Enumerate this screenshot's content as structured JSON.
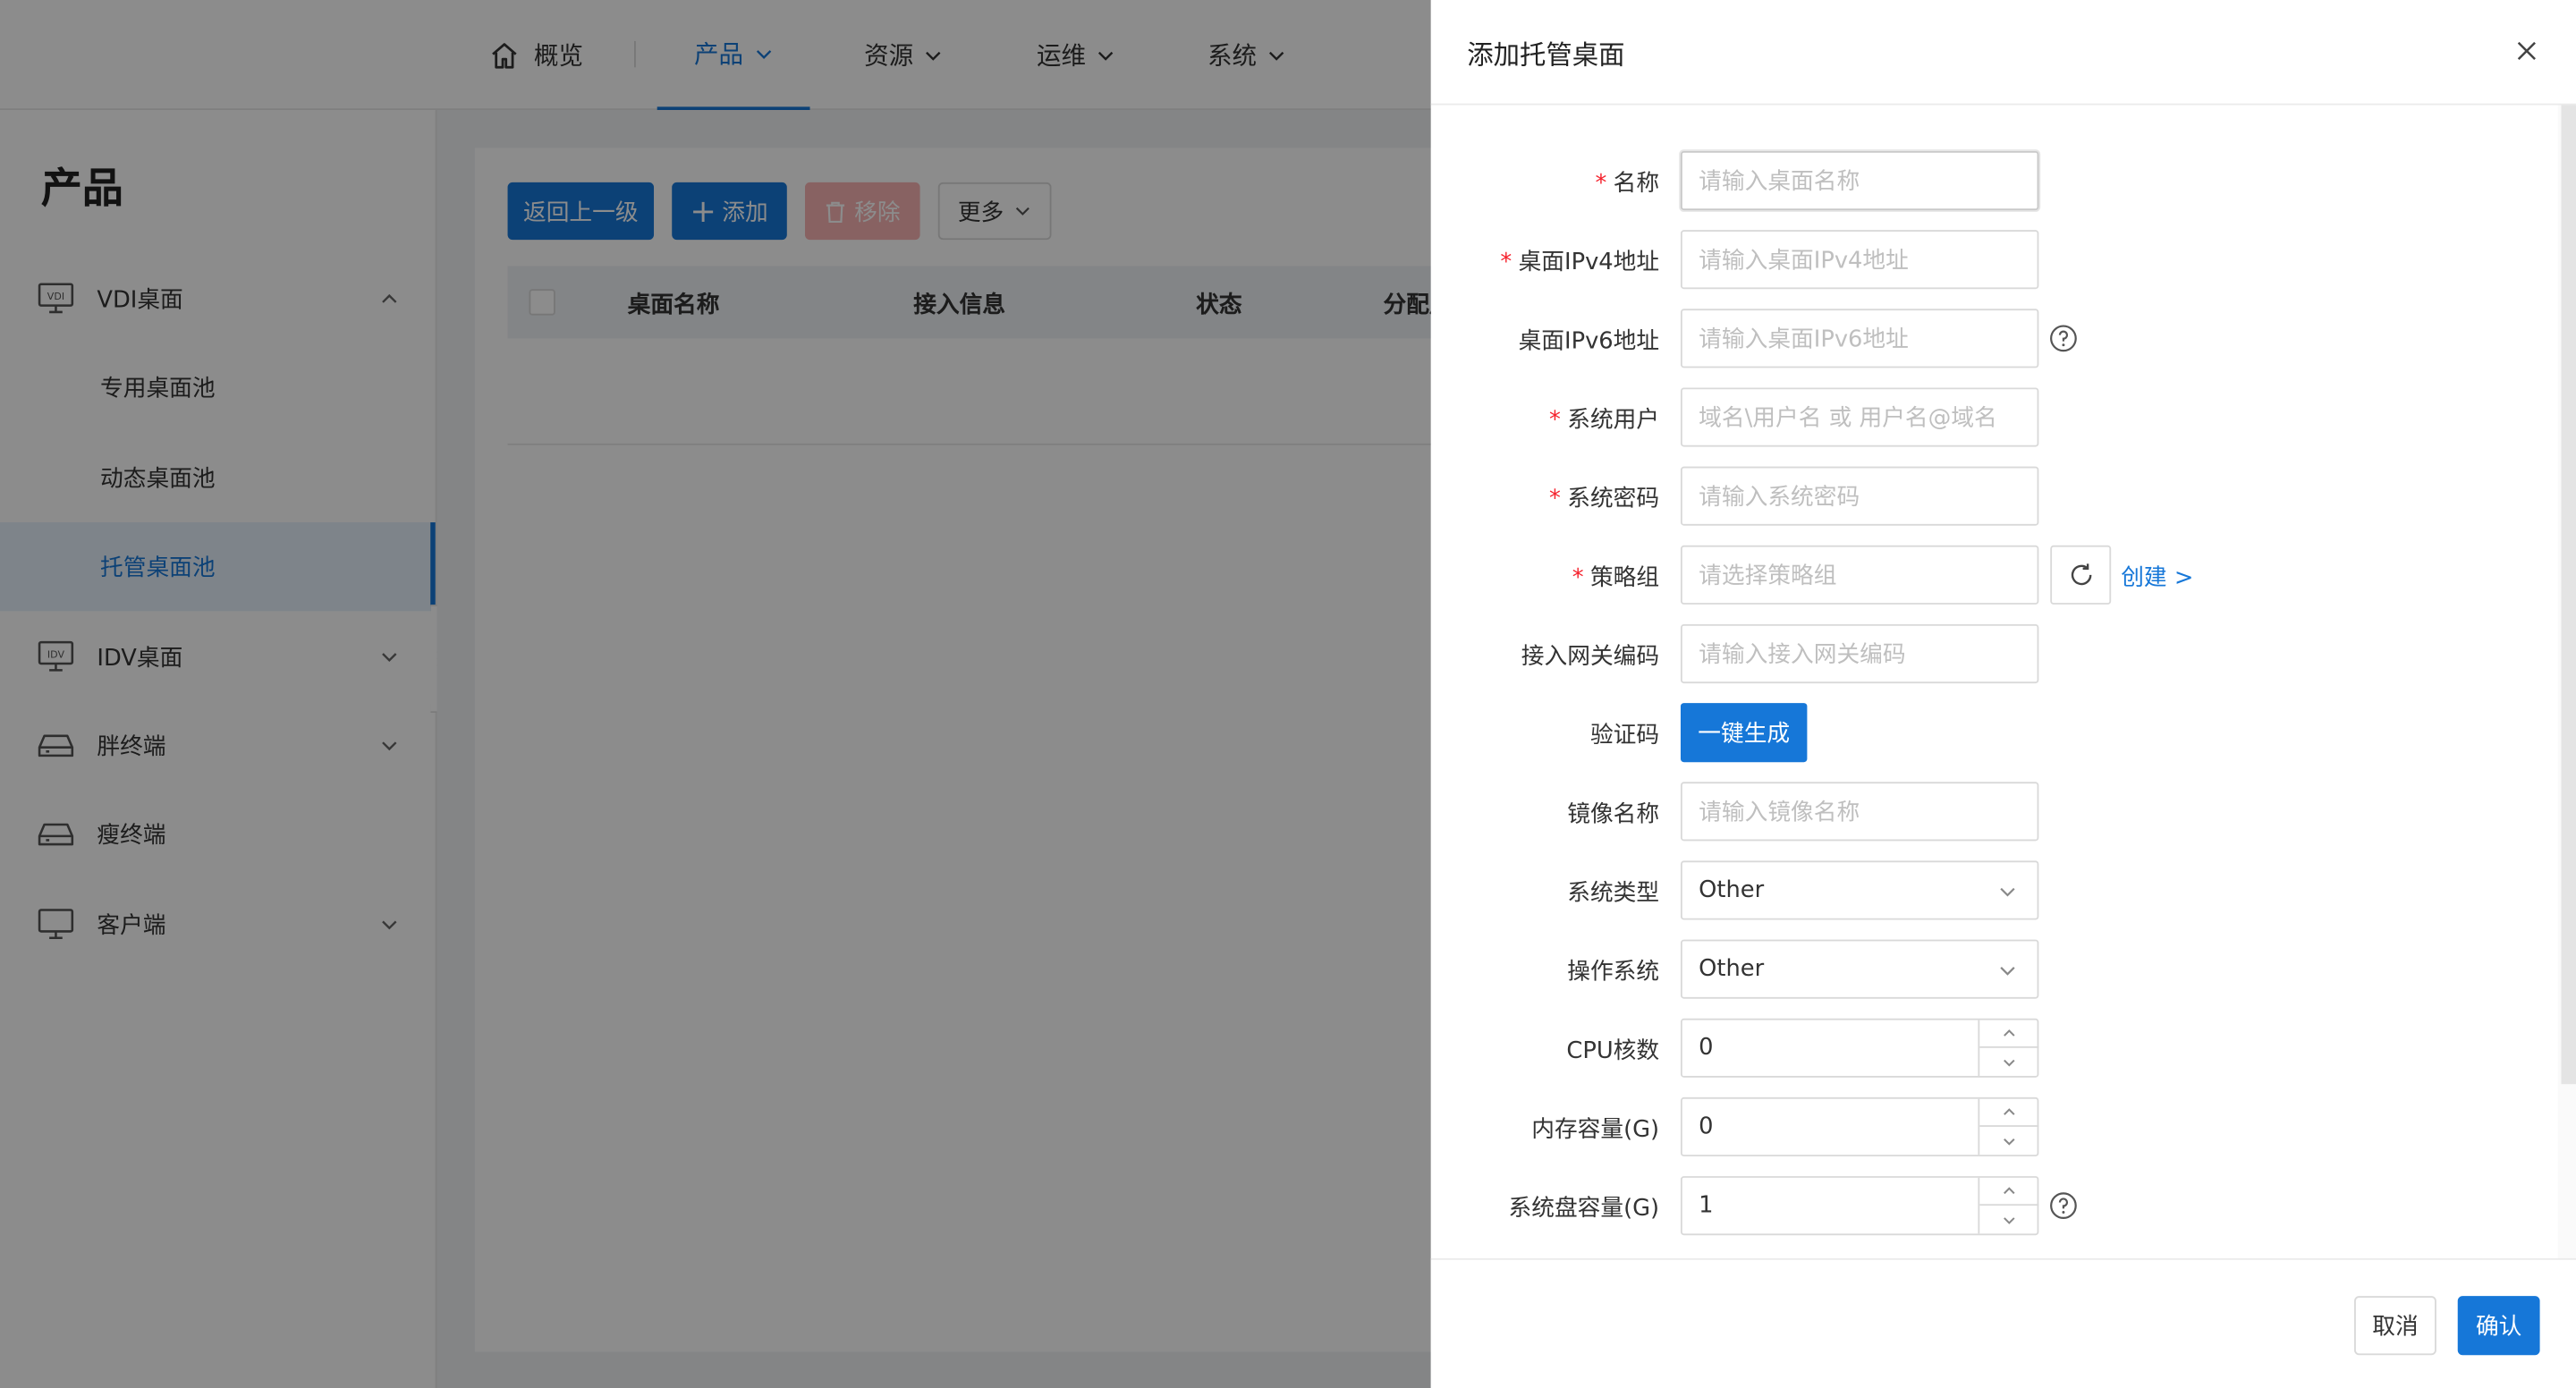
{
  "nav": {
    "items": [
      {
        "label": "概览",
        "icon": "home-icon"
      },
      {
        "label": "产品",
        "icon": "chevron-down-icon",
        "active": true
      },
      {
        "label": "资源",
        "icon": "chevron-down-icon"
      },
      {
        "label": "运维",
        "icon": "chevron-down-icon"
      },
      {
        "label": "系统",
        "icon": "chevron-down-icon"
      }
    ]
  },
  "sidebar": {
    "title": "产品",
    "items": [
      {
        "label": "VDI桌面",
        "icon": "vdi-monitor-icon",
        "expanded": true
      },
      {
        "label": "专用桌面池"
      },
      {
        "label": "动态桌面池"
      },
      {
        "label": "托管桌面池",
        "active": true
      },
      {
        "label": "IDV桌面",
        "icon": "idv-monitor-icon"
      },
      {
        "label": "胖终端",
        "icon": "terminal-device-icon"
      },
      {
        "label": "瘦终端",
        "icon": "terminal-device-icon"
      },
      {
        "label": "客户端",
        "icon": "desktop-monitor-icon"
      }
    ]
  },
  "toolbar": {
    "back_label": "返回上一级",
    "add_label": "添加",
    "remove_label": "移除",
    "more_label": "更多"
  },
  "table": {
    "columns": [
      "桌面名称",
      "接入信息",
      "状态",
      "分配用"
    ]
  },
  "drawer": {
    "title": "添加托管桌面",
    "fields": {
      "name": {
        "label": "名称",
        "required": true,
        "placeholder": "请输入桌面名称"
      },
      "ipv4": {
        "label": "桌面IPv4地址",
        "required": true,
        "placeholder": "请输入桌面IPv4地址"
      },
      "ipv6": {
        "label": "桌面IPv6地址",
        "required": false,
        "placeholder": "请输入桌面IPv6地址"
      },
      "sys_user": {
        "label": "系统用户",
        "required": true,
        "placeholder": "域名\\用户名 或 用户名@域名"
      },
      "sys_password": {
        "label": "系统密码",
        "required": true,
        "placeholder": "请输入系统密码"
      },
      "policy": {
        "label": "策略组",
        "required": true,
        "placeholder": "请选择策略组",
        "create_link": "创建 >"
      },
      "gateway": {
        "label": "接入网关编码",
        "required": false,
        "placeholder": "请输入接入网关编码"
      },
      "verify": {
        "label": "验证码",
        "button": "一键生成"
      },
      "image": {
        "label": "镜像名称",
        "placeholder": "请输入镜像名称"
      },
      "sys_type": {
        "label": "系统类型",
        "value": "Other"
      },
      "os": {
        "label": "操作系统",
        "value": "Other"
      },
      "cpu": {
        "label": "CPU核数",
        "value": "0"
      },
      "memory": {
        "label": "内存容量(G)",
        "value": "0"
      },
      "disk": {
        "label": "系统盘容量(G)",
        "value": "1"
      }
    },
    "footer": {
      "cancel_label": "取消",
      "ok_label": "确认"
    }
  },
  "colors": {
    "primary": "#1677d8",
    "danger_disabled": "#f7b2b2",
    "required": "#f5222d"
  }
}
